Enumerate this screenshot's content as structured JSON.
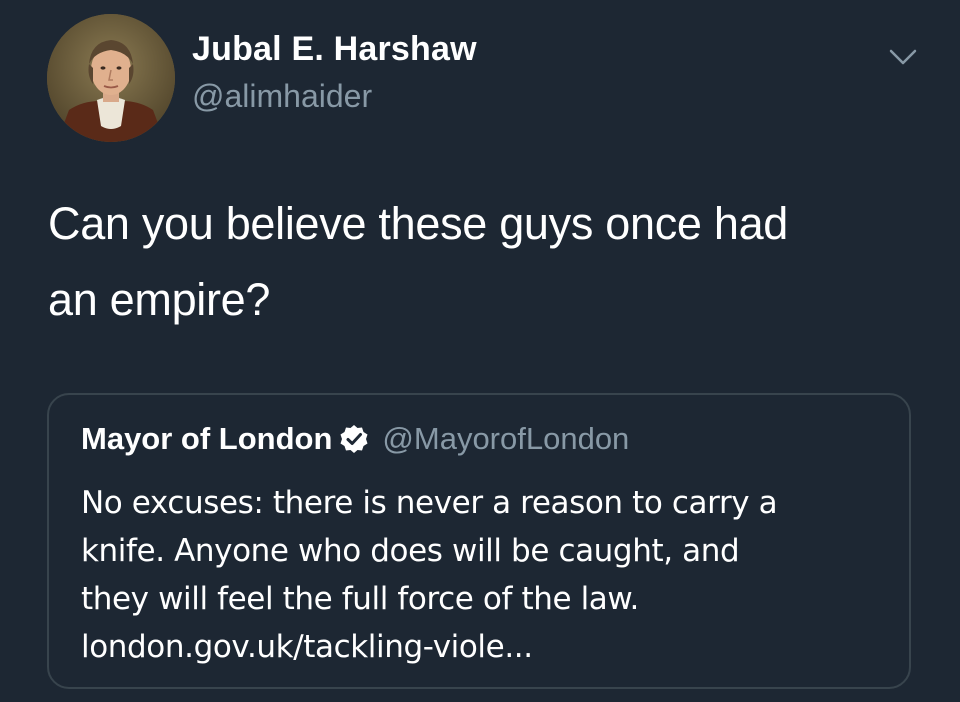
{
  "tweet": {
    "author": {
      "display_name": "Jubal E. Harshaw",
      "handle": "@alimhaider",
      "avatar_icon": "portrait-avatar"
    },
    "menu_icon": "chevron-down-icon",
    "text_lines": [
      "Can you believe these guys once had",
      "an empire?"
    ]
  },
  "quoted_tweet": {
    "display_name": "Mayor of London",
    "verified_icon": "verified-badge-icon",
    "handle": "@MayorofLondon",
    "text_lines": [
      "No excuses: there is never a reason to carry a",
      "knife. Anyone who does will be caught, and",
      "they will feel the full force of the law.",
      "london.gov.uk/tackling-viole..."
    ]
  },
  "colors": {
    "background": "#1d2733",
    "primary_text": "#ffffff",
    "secondary_text": "#8899a6",
    "card_border": "#38444d"
  }
}
